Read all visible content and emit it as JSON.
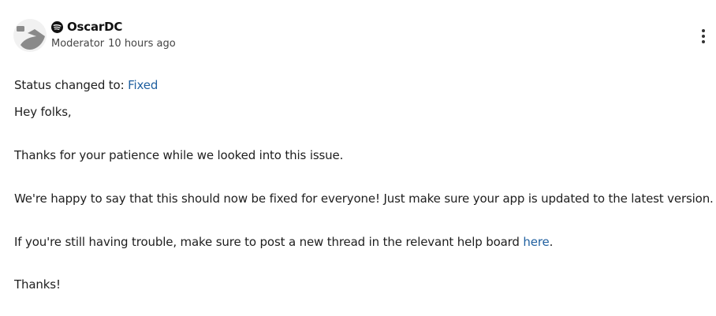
{
  "post": {
    "author": {
      "name": "OscarDC",
      "role": "Moderator",
      "timestamp": "10 hours ago",
      "avatar_icon": "default-avatar-icon",
      "badge_icon": "spotify-logo-icon"
    },
    "menu_icon": "more-vertical-icon",
    "status": {
      "prefix": "Status changed to: ",
      "value": "Fixed"
    },
    "body": {
      "greeting": "Hey folks,",
      "paragraph_1": "Thanks for your patience while we looked into this issue.",
      "paragraph_2": "We're happy to say that this should now be fixed for everyone! Just make sure your app is updated to the latest version.",
      "paragraph_3_prefix": "If you're still having trouble, make sure to post a new thread in the relevant help board ",
      "paragraph_3_link": "here",
      "paragraph_3_suffix": ".",
      "closing": "Thanks!"
    }
  },
  "colors": {
    "link": "#1f5f9f",
    "text": "#1e1e1e",
    "avatar": "#8a8a8a"
  }
}
